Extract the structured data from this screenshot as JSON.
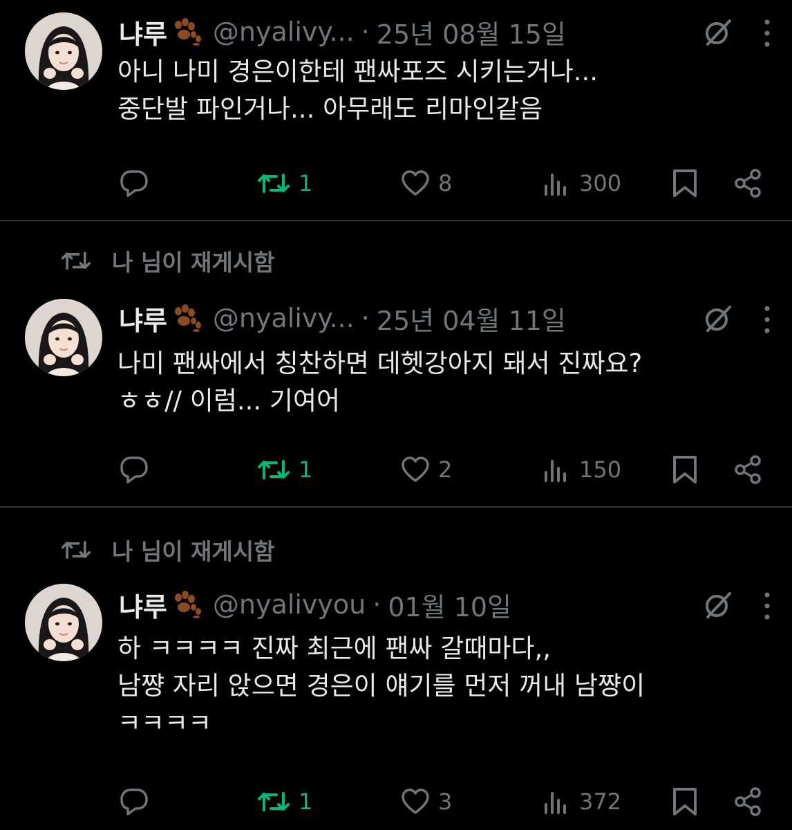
{
  "tweets": [
    {
      "reposted_by": "",
      "author": {
        "display_name": "냐루",
        "handle": "@nyalivy...",
        "date": "25년 08월 15일"
      },
      "text_lines": [
        "아니 나미 경은이한테 팬싸포즈 시키는거나...",
        "중단발 파인거나... 아무래도 리마인같음"
      ],
      "stats": {
        "replies": "",
        "reposts": "1",
        "likes": "8",
        "views": "300"
      }
    },
    {
      "reposted_by": "나 님이 재게시함",
      "author": {
        "display_name": "냐루",
        "handle": "@nyalivy...",
        "date": "25년 04월 11일"
      },
      "text_lines": [
        "나미 팬싸에서 칭찬하면 데헷강아지 돼서 진짜요?",
        "ㅎㅎ// 이럼... 기여어"
      ],
      "stats": {
        "replies": "",
        "reposts": "1",
        "likes": "2",
        "views": "150"
      }
    },
    {
      "reposted_by": "나 님이 재게시함",
      "author": {
        "display_name": "냐루",
        "handle": "@nyalivyou",
        "date": "01월 10일"
      },
      "text_lines": [
        "하 ㅋㅋㅋㅋ 진짜 최근에 팬싸 갈때마다,,",
        "남쨩 자리 앉으면 경은이 얘기를 먼저 꺼내 남쨩이",
        "ㅋㅋㅋㅋ"
      ],
      "stats": {
        "replies": "",
        "reposts": "1",
        "likes": "3",
        "views": "372"
      }
    }
  ],
  "dot_separator": "·",
  "colors": {
    "background": "#000000",
    "text_primary": "#e7e9ea",
    "text_secondary": "#71767b",
    "repost_active": "#00ba7c",
    "divider": "#2f3336"
  },
  "icons": [
    "reply-icon",
    "repost-icon",
    "like-icon",
    "views-icon",
    "bookmark-icon",
    "share-icon",
    "grok-icon",
    "more-icon",
    "paw-emoji"
  ]
}
